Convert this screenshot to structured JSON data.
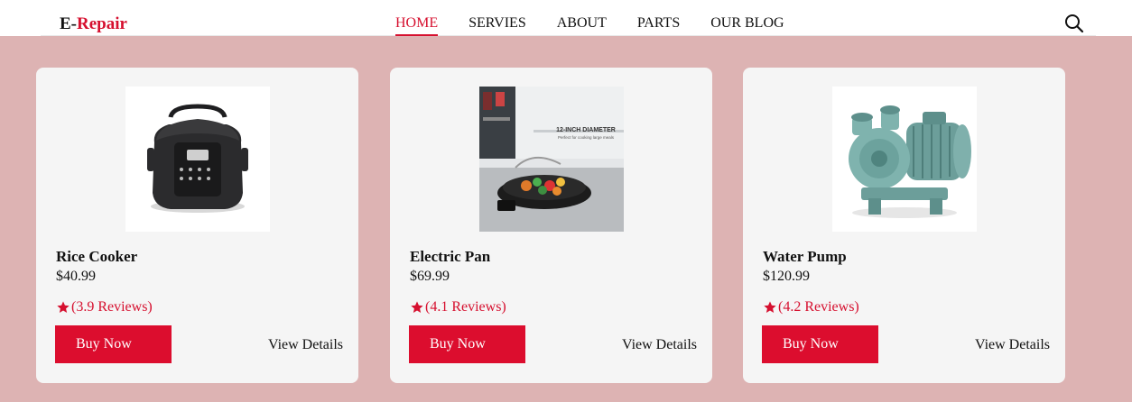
{
  "header": {
    "logo_prefix": "E-",
    "logo_accent": "Repair",
    "nav": [
      {
        "label": "HOME",
        "active": true
      },
      {
        "label": "SERVIES",
        "active": false
      },
      {
        "label": "ABOUT",
        "active": false
      },
      {
        "label": "PARTS",
        "active": false
      },
      {
        "label": "OUR BLOG",
        "active": false
      }
    ],
    "search_icon": "search-icon"
  },
  "colors": {
    "page_background": "#ddb3b3",
    "accent": "#d6102f",
    "button": "#dc0d2e",
    "card_background": "#f5f5f5"
  },
  "products": [
    {
      "title": "Rice Cooker",
      "price": "$40.99",
      "rating": "(3.9  Reviews)",
      "buy_label": "Buy Now",
      "details_label": "View Details",
      "image_icon": "rice-cooker-image"
    },
    {
      "title": "Electric Pan",
      "price": "$69.99",
      "rating": "(4.1  Reviews)",
      "buy_label": "Buy Now",
      "details_label": "View Details",
      "image_icon": "electric-pan-image",
      "image_caption_line1": "12-INCH DIAMETER",
      "image_caption_line2": "Perfect for cooking large meals"
    },
    {
      "title": "Water Pump",
      "price": "$120.99",
      "rating": "(4.2  Reviews)",
      "buy_label": "Buy Now",
      "details_label": "View Details",
      "image_icon": "water-pump-image"
    }
  ]
}
